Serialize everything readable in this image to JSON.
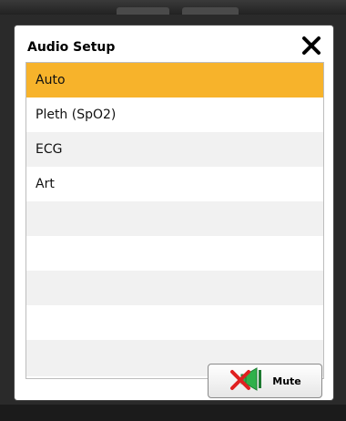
{
  "dialog": {
    "title": "Audio Setup",
    "close_icon": "close-icon",
    "items": [
      {
        "label": "Auto",
        "selected": true
      },
      {
        "label": "Pleth (SpO2)",
        "selected": false
      },
      {
        "label": "ECG",
        "selected": false
      },
      {
        "label": "Art",
        "selected": false
      }
    ],
    "empty_rows": 4,
    "mute_button": {
      "label": "Mute",
      "icon": "speaker-muted-icon"
    }
  },
  "colors": {
    "selection": "#f7b32b",
    "mute_x": "#e02020",
    "speaker": "#2fb14a"
  }
}
